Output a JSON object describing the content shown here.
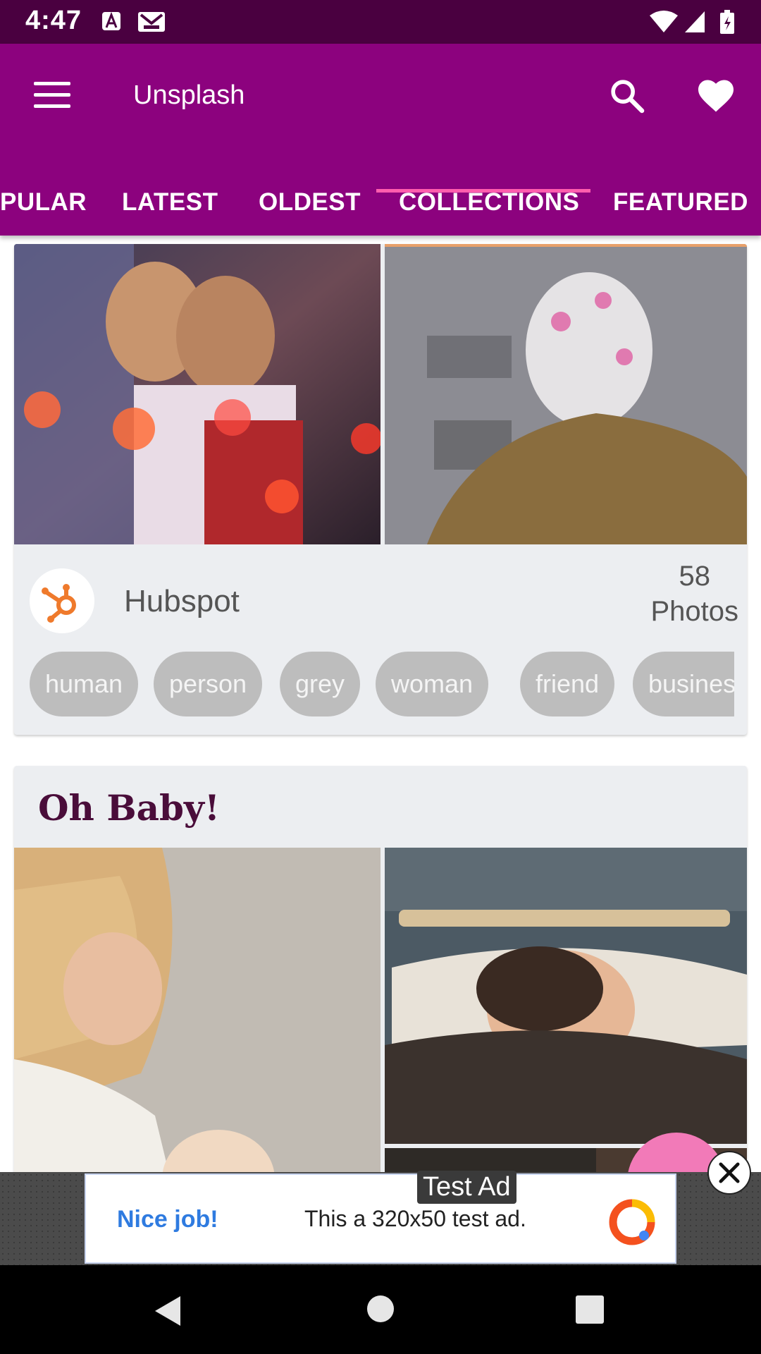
{
  "status_bar": {
    "time": "4:47",
    "icons": [
      "a-notification-icon",
      "gmail-icon",
      "wifi-icon",
      "signal-icon",
      "battery-icon"
    ]
  },
  "app_bar": {
    "title": "Unsplash",
    "icons": [
      "menu-icon",
      "search-icon",
      "heart-icon"
    ]
  },
  "tabs": [
    {
      "label": "PULAR"
    },
    {
      "label": "LATEST"
    },
    {
      "label": "OLDEST"
    },
    {
      "label": "COLLECTIONS"
    },
    {
      "label": "FEATURED"
    }
  ],
  "selected_tab": "COLLECTIONS",
  "collections": [
    {
      "name": "Hubspot",
      "count_number": "58",
      "count_unit": "Photos",
      "tags": [
        "human",
        "person",
        "grey",
        "woman",
        "friend",
        "business"
      ]
    },
    {
      "name": "Oh Baby!"
    }
  ],
  "ad": {
    "label": "Test Ad",
    "headline": "Nice job!",
    "text": "This a 320x50 test ad."
  },
  "colors": {
    "primary": "#8c027e",
    "status_bar": "#4a0040",
    "tab_indicator": "#ff5dae",
    "fab": "#f27ab8",
    "card_bg": "#eceef1"
  }
}
